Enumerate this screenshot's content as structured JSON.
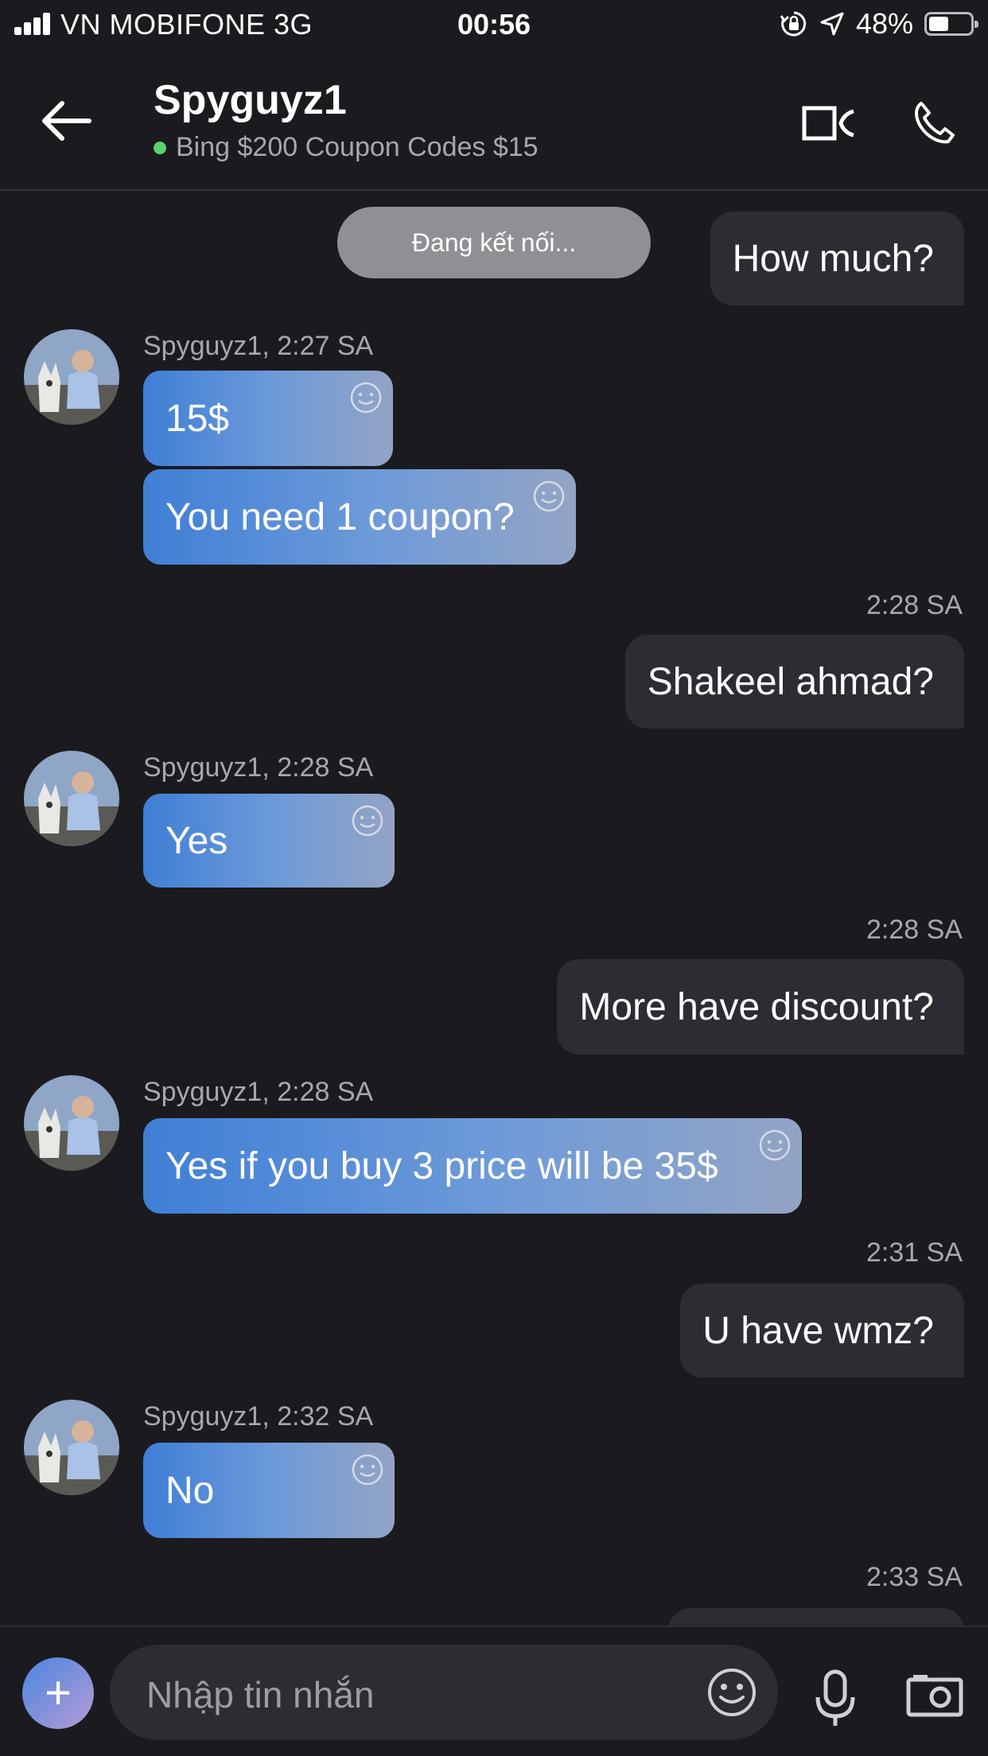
{
  "status_bar": {
    "carrier": "VN MOBIFONE   3G",
    "time": "00:56",
    "battery": "48%",
    "battery_level": 0.48
  },
  "header": {
    "name": "Spyguyz1",
    "subtitle": "Bing $200 Coupon Codes $15"
  },
  "chat": {
    "connecting": "Đang kết nối...",
    "out_1": "How much?",
    "meta_1": "Spyguyz1, 2:27 SA",
    "in_1a": "15$",
    "in_1b": "You need 1 coupon?",
    "ts_1": "2:28 SA",
    "out_2": "Shakeel ahmad?",
    "meta_2": "Spyguyz1, 2:28 SA",
    "in_2": "Yes",
    "ts_2": "2:28 SA",
    "out_3": "More have discount?",
    "meta_3": "Spyguyz1, 2:28 SA",
    "in_3": "Yes if you buy 3 price will be 35$",
    "ts_3": "2:31 SA",
    "out_4": "U have wmz?",
    "meta_4": "Spyguyz1, 2:32 SA",
    "in_4": "No",
    "ts_4": "2:33 SA"
  },
  "composer": {
    "placeholder": "Nhập tin nhắn"
  },
  "colors": {
    "background": "#1b1b1f",
    "bubble_out": "#2c2c33",
    "bubble_in_start": "#3f7fd6",
    "bubble_in_end": "#93a4c4",
    "online_dot": "#5ad36a"
  }
}
